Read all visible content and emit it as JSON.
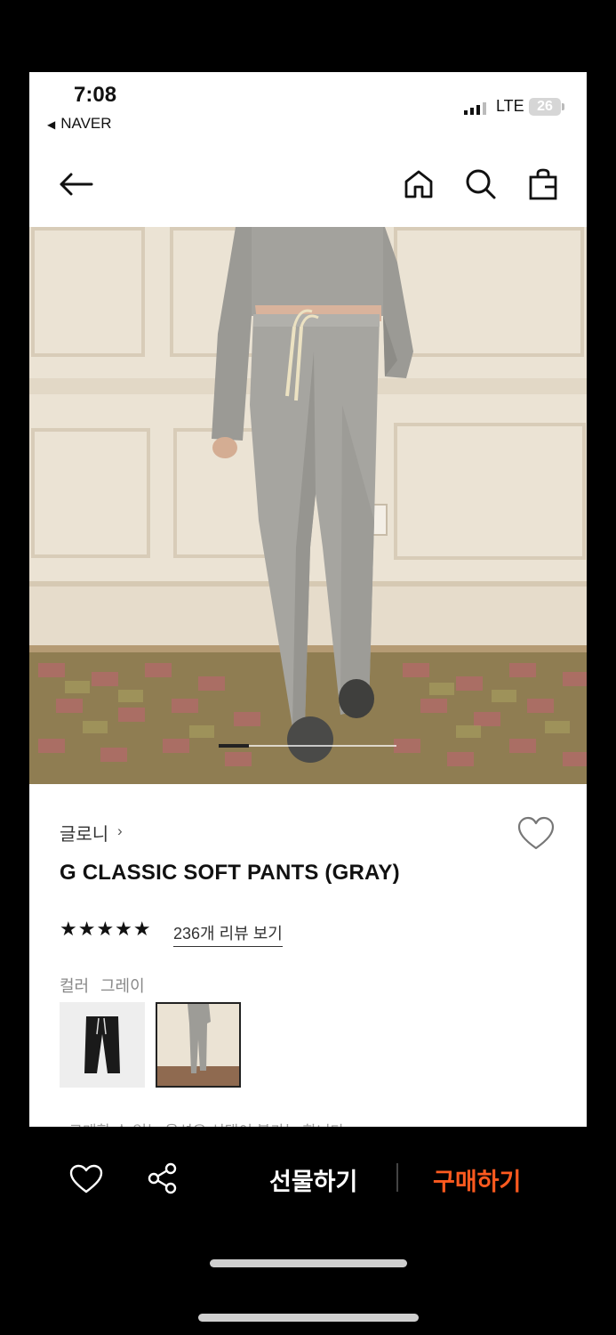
{
  "status_bar": {
    "time": "7:08",
    "back_app": "NAVER",
    "network": "LTE",
    "battery": "26"
  },
  "product": {
    "brand": "글로니",
    "brand_chevron": "›",
    "title": "G CLASSIC SOFT PANTS (GRAY)",
    "rating_stars": 5,
    "stars_display": "★★★★★",
    "review_link": "236개 리뷰 보기",
    "color_label": "컬러",
    "color_value": "그레이",
    "notice": "· 구매할 수 없는 옵션은 선택이 불가능 합니다"
  },
  "image_carousel": {
    "current_index": 1,
    "total": 6
  },
  "bottom_bar": {
    "gift_label": "선물하기",
    "buy_label": "구매하기"
  },
  "icons": [
    "back-arrow-icon",
    "home-icon",
    "search-icon",
    "shopping-bag-icon",
    "heart-icon",
    "share-icon"
  ],
  "colors": {
    "buy_accent": "#ff5a1f",
    "background": "#ffffff",
    "bottom_bar": "#000000"
  }
}
